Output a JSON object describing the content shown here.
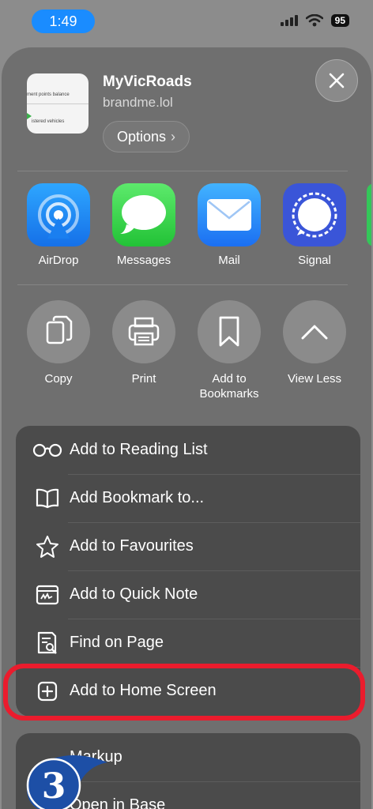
{
  "status": {
    "time": "1:49",
    "battery": "95"
  },
  "header": {
    "title": "MyVicRoads",
    "domain": "brandme.lol",
    "options_label": "Options",
    "options_chevron": "›",
    "thumb_text_1": "ment points balance",
    "thumb_text_2": "istered vehicles"
  },
  "apps": [
    {
      "label": "AirDrop",
      "icon": "airdrop-icon"
    },
    {
      "label": "Messages",
      "icon": "messages-icon"
    },
    {
      "label": "Mail",
      "icon": "mail-icon"
    },
    {
      "label": "Signal",
      "icon": "signal-icon"
    }
  ],
  "actions": [
    {
      "label": "Copy",
      "icon": "copy-icon"
    },
    {
      "label": "Print",
      "icon": "printer-icon"
    },
    {
      "label": "Add to\nBookmarks",
      "icon": "bookmark-icon"
    },
    {
      "label": "View Less",
      "icon": "chevron-up-icon"
    }
  ],
  "menu": [
    {
      "label": "Add to Reading List",
      "icon": "glasses-icon"
    },
    {
      "label": "Add Bookmark to...",
      "icon": "book-icon"
    },
    {
      "label": "Add to Favourites",
      "icon": "star-icon"
    },
    {
      "label": "Add to Quick Note",
      "icon": "quick-note-icon"
    },
    {
      "label": "Find on Page",
      "icon": "find-on-page-icon"
    },
    {
      "label": "Add to Home Screen",
      "icon": "plus-square-icon"
    }
  ],
  "menu2": [
    {
      "label": "Markup",
      "icon": "markup-icon"
    },
    {
      "label": "Open in Base",
      "icon": "square-icon"
    }
  ],
  "annotation": {
    "step_number": "3"
  },
  "colors": {
    "highlight": "#ea1c2d",
    "badge": "#1d4fa6",
    "time_pill": "#1a8cff"
  }
}
